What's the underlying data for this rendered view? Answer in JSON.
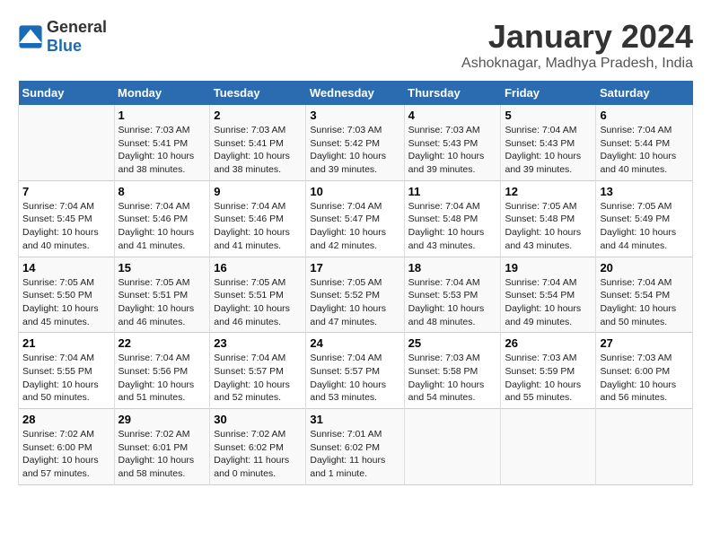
{
  "header": {
    "logo_general": "General",
    "logo_blue": "Blue",
    "title": "January 2024",
    "subtitle": "Ashoknagar, Madhya Pradesh, India"
  },
  "columns": [
    "Sunday",
    "Monday",
    "Tuesday",
    "Wednesday",
    "Thursday",
    "Friday",
    "Saturday"
  ],
  "weeks": [
    [
      {
        "day": "",
        "info": ""
      },
      {
        "day": "1",
        "info": "Sunrise: 7:03 AM\nSunset: 5:41 PM\nDaylight: 10 hours\nand 38 minutes."
      },
      {
        "day": "2",
        "info": "Sunrise: 7:03 AM\nSunset: 5:41 PM\nDaylight: 10 hours\nand 38 minutes."
      },
      {
        "day": "3",
        "info": "Sunrise: 7:03 AM\nSunset: 5:42 PM\nDaylight: 10 hours\nand 39 minutes."
      },
      {
        "day": "4",
        "info": "Sunrise: 7:03 AM\nSunset: 5:43 PM\nDaylight: 10 hours\nand 39 minutes."
      },
      {
        "day": "5",
        "info": "Sunrise: 7:04 AM\nSunset: 5:43 PM\nDaylight: 10 hours\nand 39 minutes."
      },
      {
        "day": "6",
        "info": "Sunrise: 7:04 AM\nSunset: 5:44 PM\nDaylight: 10 hours\nand 40 minutes."
      }
    ],
    [
      {
        "day": "7",
        "info": "Sunrise: 7:04 AM\nSunset: 5:45 PM\nDaylight: 10 hours\nand 40 minutes."
      },
      {
        "day": "8",
        "info": "Sunrise: 7:04 AM\nSunset: 5:46 PM\nDaylight: 10 hours\nand 41 minutes."
      },
      {
        "day": "9",
        "info": "Sunrise: 7:04 AM\nSunset: 5:46 PM\nDaylight: 10 hours\nand 41 minutes."
      },
      {
        "day": "10",
        "info": "Sunrise: 7:04 AM\nSunset: 5:47 PM\nDaylight: 10 hours\nand 42 minutes."
      },
      {
        "day": "11",
        "info": "Sunrise: 7:04 AM\nSunset: 5:48 PM\nDaylight: 10 hours\nand 43 minutes."
      },
      {
        "day": "12",
        "info": "Sunrise: 7:05 AM\nSunset: 5:48 PM\nDaylight: 10 hours\nand 43 minutes."
      },
      {
        "day": "13",
        "info": "Sunrise: 7:05 AM\nSunset: 5:49 PM\nDaylight: 10 hours\nand 44 minutes."
      }
    ],
    [
      {
        "day": "14",
        "info": "Sunrise: 7:05 AM\nSunset: 5:50 PM\nDaylight: 10 hours\nand 45 minutes."
      },
      {
        "day": "15",
        "info": "Sunrise: 7:05 AM\nSunset: 5:51 PM\nDaylight: 10 hours\nand 46 minutes."
      },
      {
        "day": "16",
        "info": "Sunrise: 7:05 AM\nSunset: 5:51 PM\nDaylight: 10 hours\nand 46 minutes."
      },
      {
        "day": "17",
        "info": "Sunrise: 7:05 AM\nSunset: 5:52 PM\nDaylight: 10 hours\nand 47 minutes."
      },
      {
        "day": "18",
        "info": "Sunrise: 7:04 AM\nSunset: 5:53 PM\nDaylight: 10 hours\nand 48 minutes."
      },
      {
        "day": "19",
        "info": "Sunrise: 7:04 AM\nSunset: 5:54 PM\nDaylight: 10 hours\nand 49 minutes."
      },
      {
        "day": "20",
        "info": "Sunrise: 7:04 AM\nSunset: 5:54 PM\nDaylight: 10 hours\nand 50 minutes."
      }
    ],
    [
      {
        "day": "21",
        "info": "Sunrise: 7:04 AM\nSunset: 5:55 PM\nDaylight: 10 hours\nand 50 minutes."
      },
      {
        "day": "22",
        "info": "Sunrise: 7:04 AM\nSunset: 5:56 PM\nDaylight: 10 hours\nand 51 minutes."
      },
      {
        "day": "23",
        "info": "Sunrise: 7:04 AM\nSunset: 5:57 PM\nDaylight: 10 hours\nand 52 minutes."
      },
      {
        "day": "24",
        "info": "Sunrise: 7:04 AM\nSunset: 5:57 PM\nDaylight: 10 hours\nand 53 minutes."
      },
      {
        "day": "25",
        "info": "Sunrise: 7:03 AM\nSunset: 5:58 PM\nDaylight: 10 hours\nand 54 minutes."
      },
      {
        "day": "26",
        "info": "Sunrise: 7:03 AM\nSunset: 5:59 PM\nDaylight: 10 hours\nand 55 minutes."
      },
      {
        "day": "27",
        "info": "Sunrise: 7:03 AM\nSunset: 6:00 PM\nDaylight: 10 hours\nand 56 minutes."
      }
    ],
    [
      {
        "day": "28",
        "info": "Sunrise: 7:02 AM\nSunset: 6:00 PM\nDaylight: 10 hours\nand 57 minutes."
      },
      {
        "day": "29",
        "info": "Sunrise: 7:02 AM\nSunset: 6:01 PM\nDaylight: 10 hours\nand 58 minutes."
      },
      {
        "day": "30",
        "info": "Sunrise: 7:02 AM\nSunset: 6:02 PM\nDaylight: 11 hours\nand 0 minutes."
      },
      {
        "day": "31",
        "info": "Sunrise: 7:01 AM\nSunset: 6:02 PM\nDaylight: 11 hours\nand 1 minute."
      },
      {
        "day": "",
        "info": ""
      },
      {
        "day": "",
        "info": ""
      },
      {
        "day": "",
        "info": ""
      }
    ]
  ]
}
